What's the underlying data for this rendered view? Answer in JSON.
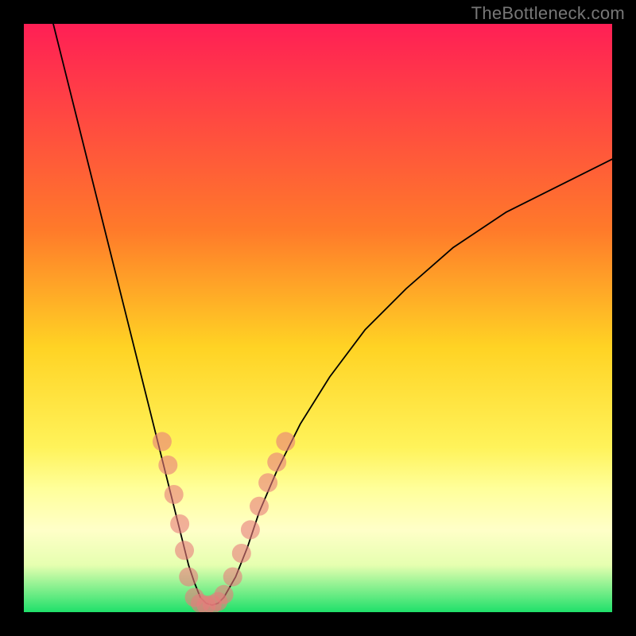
{
  "watermark": "TheBottleneck.com",
  "chart_data": {
    "type": "line",
    "title": "",
    "xlabel": "",
    "ylabel": "",
    "xlim": [
      0,
      100
    ],
    "ylim": [
      0,
      100
    ],
    "gradient_stops": [
      {
        "offset": 0,
        "color": "#ff1f55"
      },
      {
        "offset": 0.35,
        "color": "#ff7a2a"
      },
      {
        "offset": 0.55,
        "color": "#ffd324"
      },
      {
        "offset": 0.72,
        "color": "#fff35a"
      },
      {
        "offset": 0.79,
        "color": "#ffff9a"
      },
      {
        "offset": 0.86,
        "color": "#ffffc8"
      },
      {
        "offset": 0.92,
        "color": "#e6ffb0"
      },
      {
        "offset": 1.0,
        "color": "#1fe06a"
      }
    ],
    "series": [
      {
        "name": "bottleneck-curve",
        "stroke": "#000000",
        "stroke_width": 1.8,
        "x": [
          5,
          7,
          9,
          11,
          13,
          15,
          17,
          19,
          21,
          23,
          25,
          27,
          28,
          29,
          30,
          31,
          32,
          33,
          34,
          36,
          38,
          40,
          43,
          47,
          52,
          58,
          65,
          73,
          82,
          92,
          100
        ],
        "y": [
          100,
          92,
          84,
          76,
          68,
          60,
          52,
          44,
          36,
          28,
          20,
          12,
          8,
          5,
          2.5,
          1.5,
          1.2,
          1.5,
          2.5,
          6,
          11,
          17,
          24,
          32,
          40,
          48,
          55,
          62,
          68,
          73,
          77
        ]
      }
    ],
    "markers": {
      "color": "#e77b7b",
      "opacity": 0.6,
      "radius": 12,
      "points": [
        {
          "x": 23.5,
          "y": 29
        },
        {
          "x": 24.5,
          "y": 25
        },
        {
          "x": 25.5,
          "y": 20
        },
        {
          "x": 26.5,
          "y": 15
        },
        {
          "x": 27.3,
          "y": 10.5
        },
        {
          "x": 28.0,
          "y": 6
        },
        {
          "x": 29.0,
          "y": 2.5
        },
        {
          "x": 30.0,
          "y": 1.5
        },
        {
          "x": 31.0,
          "y": 1.2
        },
        {
          "x": 32.0,
          "y": 1.3
        },
        {
          "x": 33.0,
          "y": 1.8
        },
        {
          "x": 34.0,
          "y": 3
        },
        {
          "x": 35.5,
          "y": 6
        },
        {
          "x": 37.0,
          "y": 10
        },
        {
          "x": 38.5,
          "y": 14
        },
        {
          "x": 40.0,
          "y": 18
        },
        {
          "x": 41.5,
          "y": 22
        },
        {
          "x": 43.0,
          "y": 25.5
        },
        {
          "x": 44.5,
          "y": 29
        }
      ]
    }
  }
}
